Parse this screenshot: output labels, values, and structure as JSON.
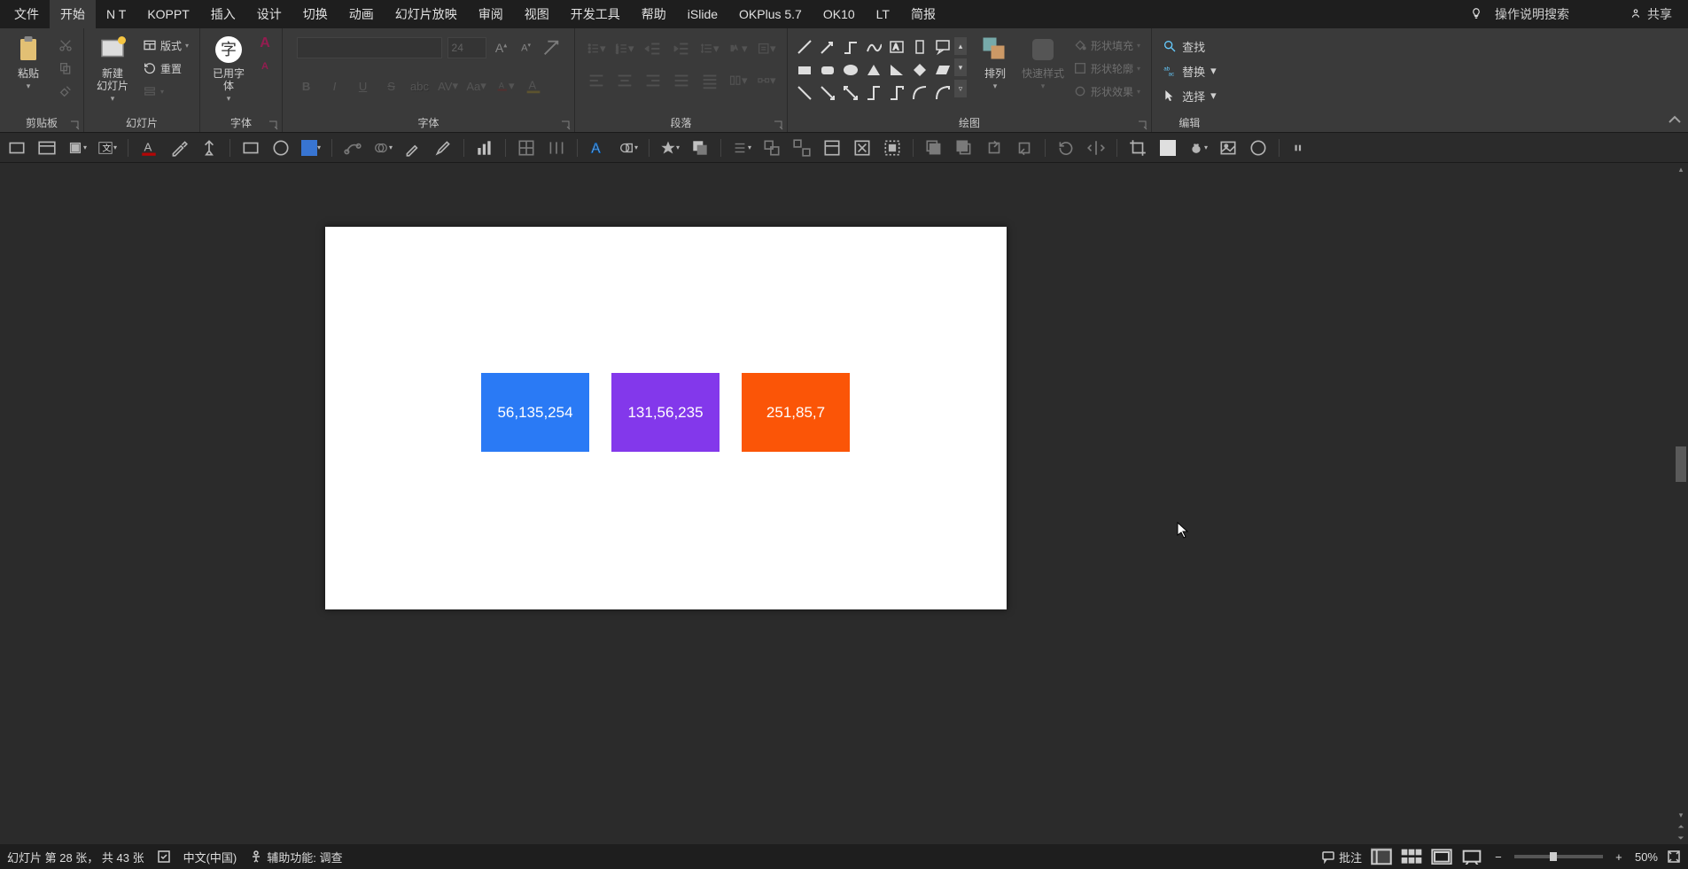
{
  "tabs": {
    "items": [
      "文件",
      "开始",
      "N T",
      "KOPPT",
      "插入",
      "设计",
      "切换",
      "动画",
      "幻灯片放映",
      "审阅",
      "视图",
      "开发工具",
      "帮助",
      "iSlide",
      "OKPlus 5.7",
      "OK10",
      "LT",
      "简报"
    ],
    "active_index": 1,
    "search_hint": "操作说明搜索",
    "share": "共享"
  },
  "ribbon": {
    "clipboard": {
      "paste": "粘贴",
      "label": "剪贴板"
    },
    "slides": {
      "new_slide": "新建\n幻灯片",
      "layout": "版式",
      "reset": "重置",
      "label": "幻灯片"
    },
    "usedfont": {
      "btn": "已用字\n体",
      "label": "字体"
    },
    "font": {
      "size_placeholder": "24",
      "label": "字体"
    },
    "para": {
      "label": "段落"
    },
    "drawing": {
      "arrange": "排列",
      "quick": "快速样式",
      "fill": "形状填充",
      "outline": "形状轮廓",
      "effects": "形状效果",
      "label": "绘图"
    },
    "editing": {
      "find": "查找",
      "replace": "替换",
      "select": "选择",
      "label": "编辑"
    }
  },
  "slide": {
    "boxes": [
      {
        "text": "56,135,254",
        "bg": "#2a7af5"
      },
      {
        "text": "131,56,235",
        "bg": "#8338eb"
      },
      {
        "text": "251,85,7",
        "bg": "#fb5507"
      }
    ]
  },
  "status": {
    "slide_info": "幻灯片 第 28 张， 共 43 张",
    "language": "中文(中国)",
    "a11y": "辅助功能: 调查",
    "notes": "批注",
    "zoom": "50%"
  }
}
